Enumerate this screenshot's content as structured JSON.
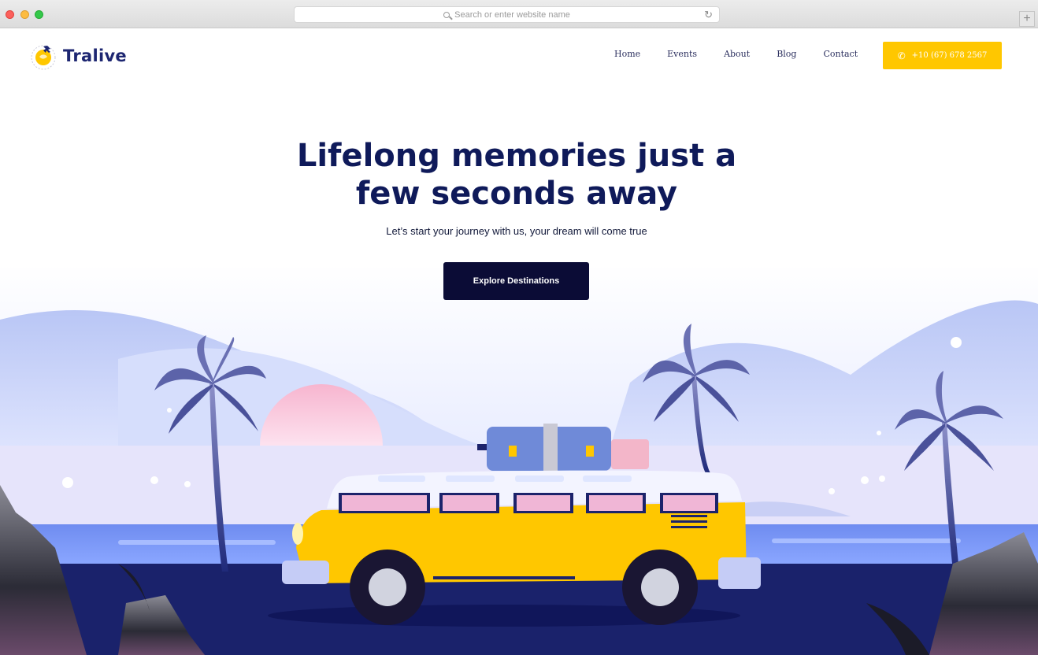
{
  "browser": {
    "address_placeholder": "Search or enter website name",
    "new_tab_label": "+"
  },
  "site": {
    "brand": "Tralive",
    "nav": [
      "Home",
      "Events",
      "About",
      "Blog",
      "Contact"
    ],
    "phone": "+10 (67) 678 2567",
    "hero": {
      "title_line1": "Lifelong memories just a",
      "title_line2": "few seconds away",
      "subtitle": "Let’s start your journey with us, your dream will come true",
      "cta": "Explore Destinations"
    }
  },
  "colors": {
    "accent": "#ffc700",
    "navy": "#0f1a5a",
    "cta_bg": "#0b0c36"
  },
  "icons": [
    "search-icon",
    "reload-icon",
    "phone-icon",
    "plane-icon"
  ]
}
